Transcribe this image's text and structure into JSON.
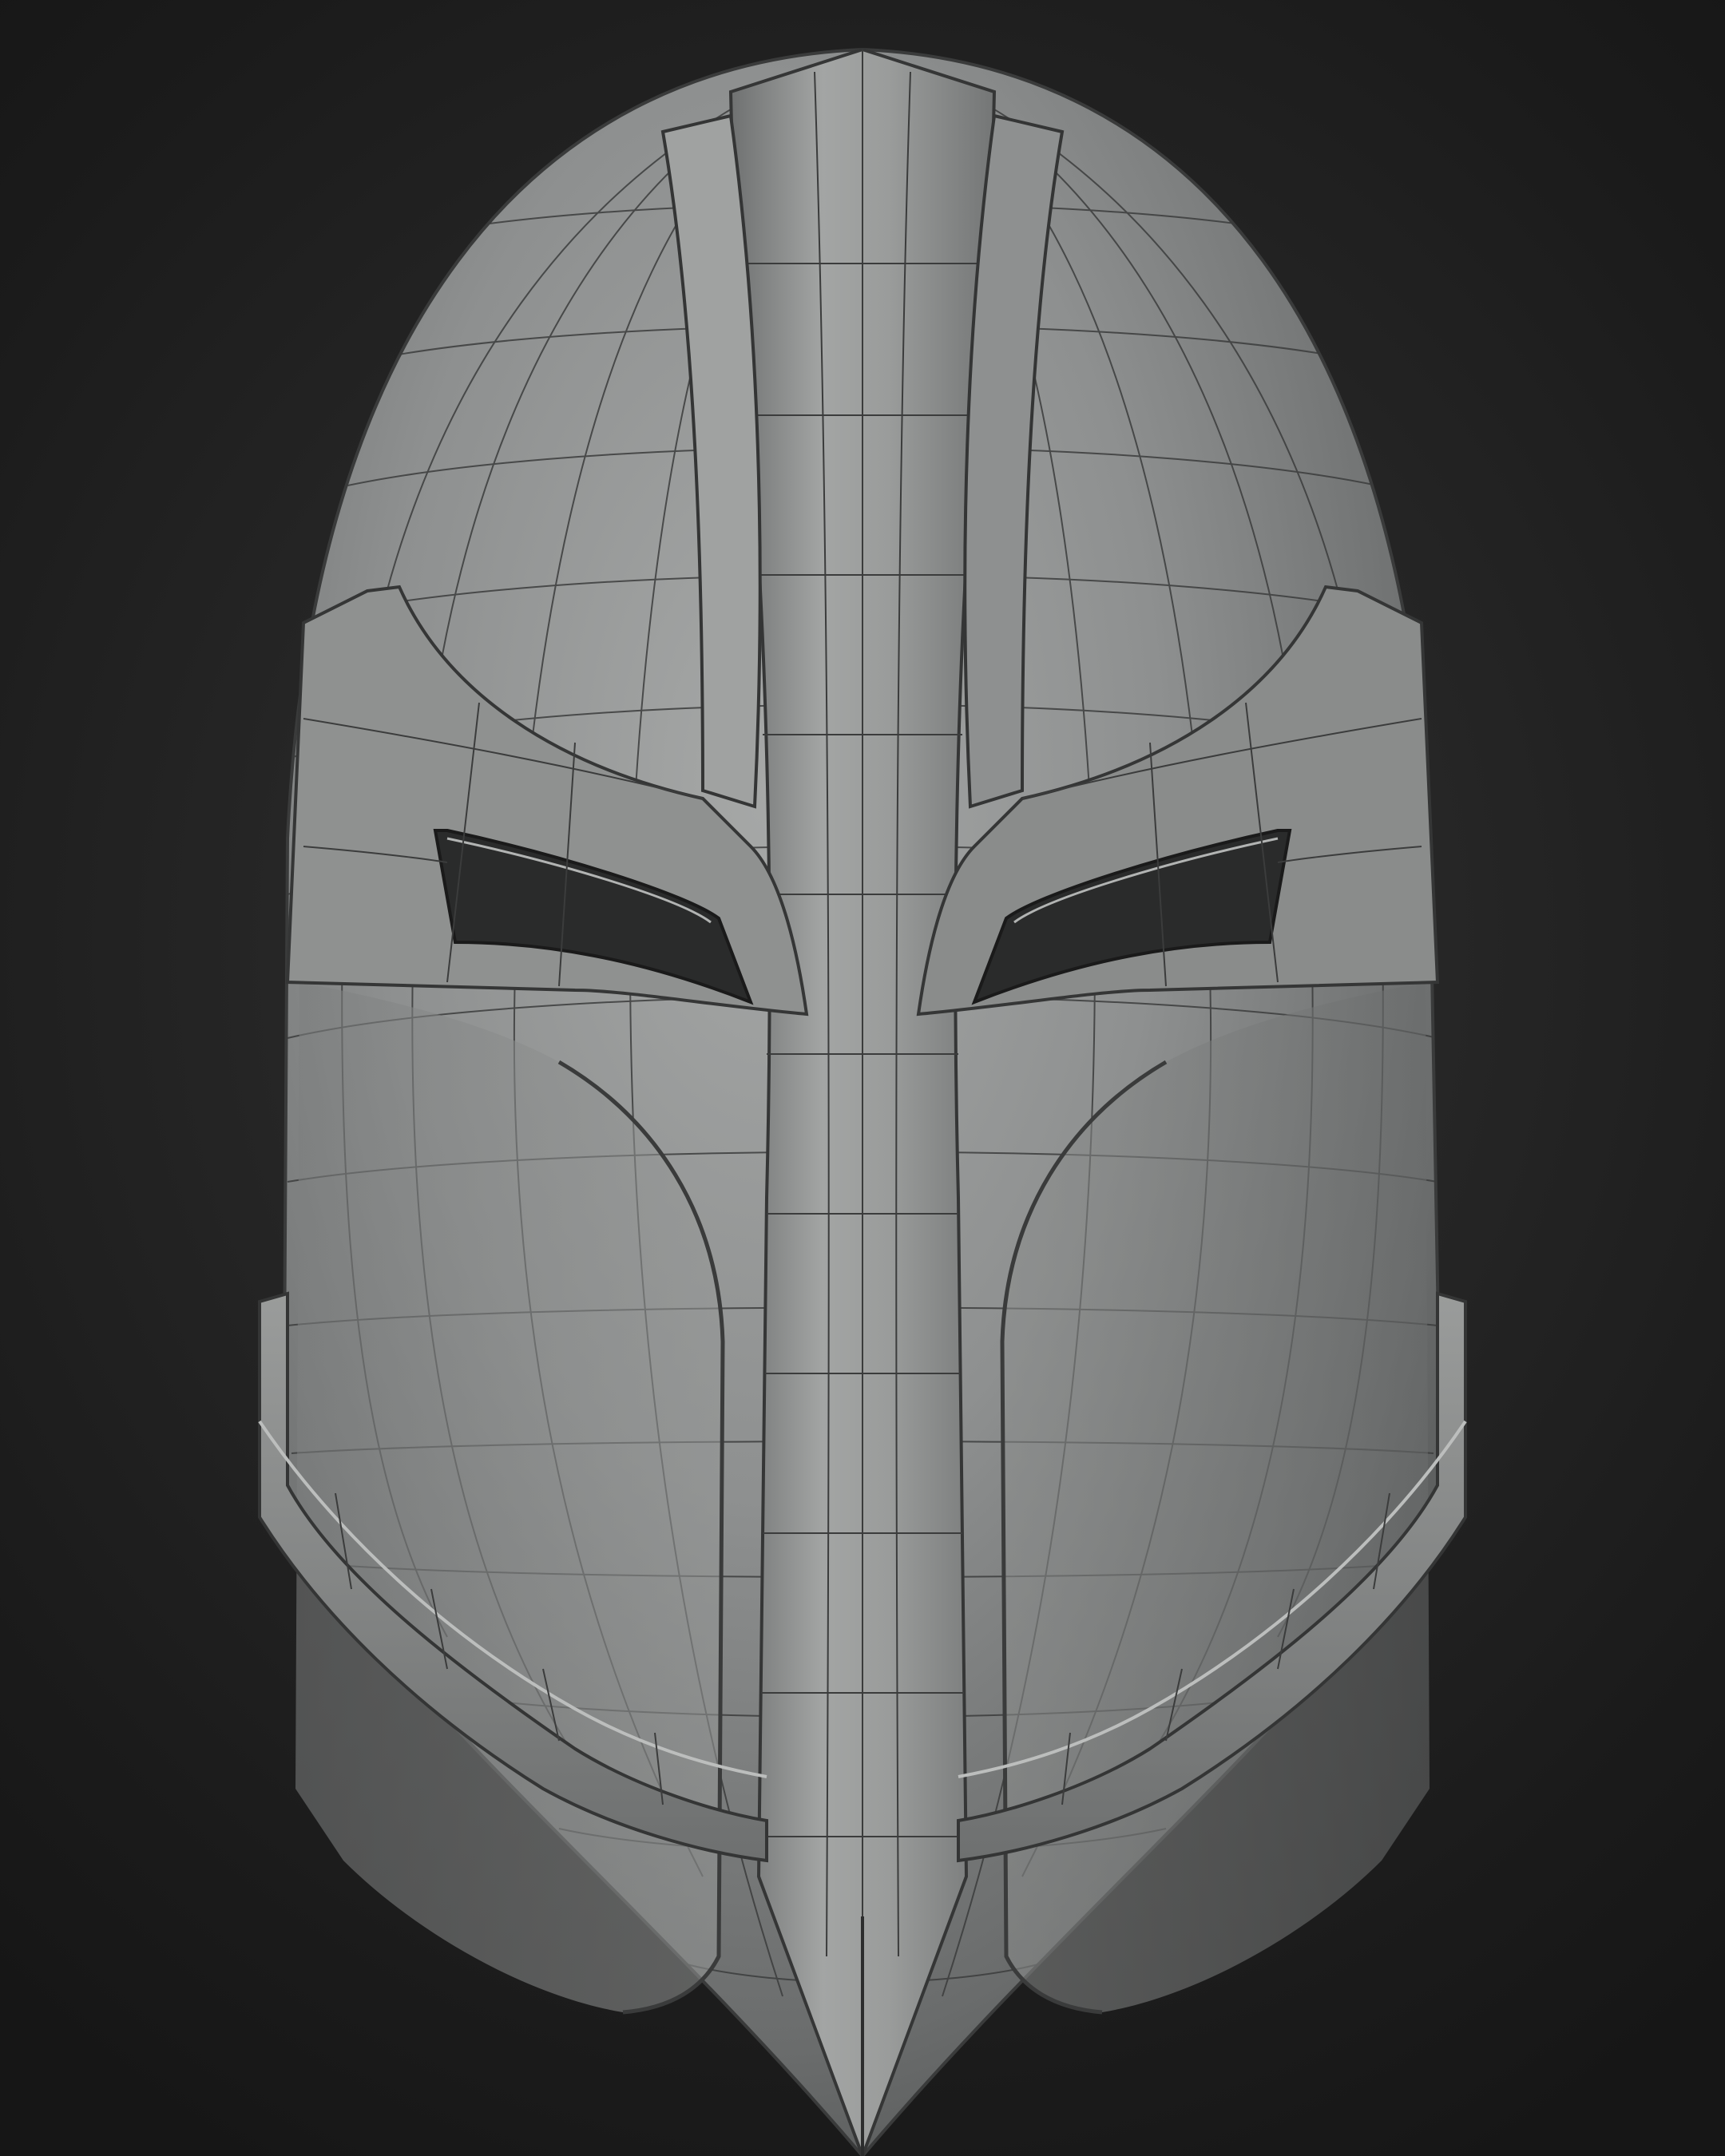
{
  "scene": {
    "subject": "helmet-wireframe-render",
    "colors": {
      "background": "#1e1e1e",
      "surface": "#8a8b8b",
      "surface_highlight": "#a7a9a8",
      "surface_shadow": "#555757",
      "wire": "#2e2f2f",
      "cavity": "#1a1a1a"
    },
    "icons": []
  }
}
